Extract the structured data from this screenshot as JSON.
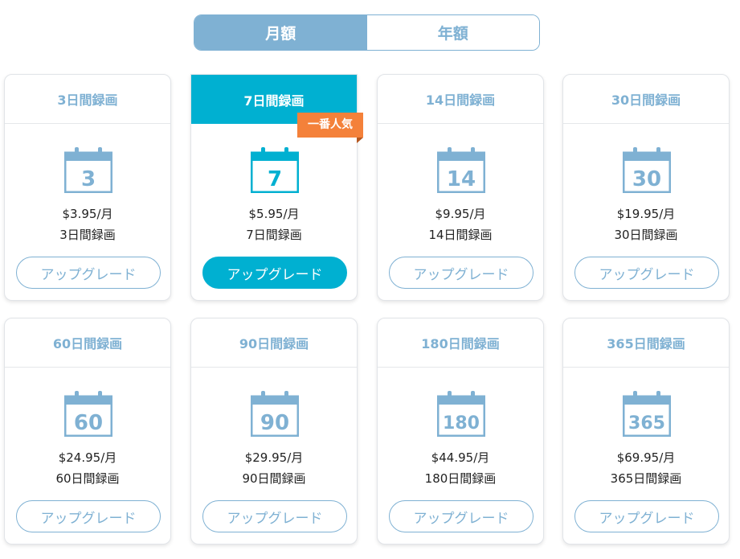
{
  "billing_toggle": {
    "monthly": "月額",
    "yearly": "年額"
  },
  "colors": {
    "accent": "#7fb1d3",
    "featured": "#00b0d1",
    "badge": "#f4813a"
  },
  "plans": [
    {
      "title": "3日間録画",
      "num": "3",
      "price": "$3.95/月",
      "label": "3日間録画",
      "button": "アップグレード"
    },
    {
      "title": "7日間録画",
      "num": "7",
      "price": "$5.95/月",
      "label": "7日間録画",
      "button": "アップグレード",
      "badge": "一番人気"
    },
    {
      "title": "14日間録画",
      "num": "14",
      "price": "$9.95/月",
      "label": "14日間録画",
      "button": "アップグレード"
    },
    {
      "title": "30日間録画",
      "num": "30",
      "price": "$19.95/月",
      "label": "30日間録画",
      "button": "アップグレード"
    },
    {
      "title": "60日間録画",
      "num": "60",
      "price": "$24.95/月",
      "label": "60日間録画",
      "button": "アップグレード"
    },
    {
      "title": "90日間録画",
      "num": "90",
      "price": "$29.95/月",
      "label": "90日間録画",
      "button": "アップグレード"
    },
    {
      "title": "180日間録画",
      "num": "180",
      "price": "$44.95/月",
      "label": "180日間録画",
      "button": "アップグレード"
    },
    {
      "title": "365日間録画",
      "num": "365",
      "price": "$69.95/月",
      "label": "365日間録画",
      "button": "アップグレード"
    }
  ]
}
